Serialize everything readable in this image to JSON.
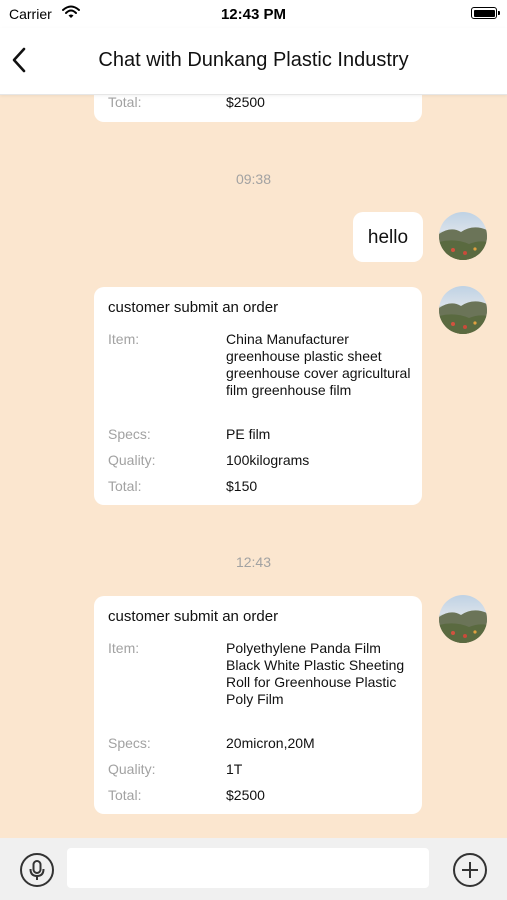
{
  "status_bar": {
    "carrier": "Carrier",
    "time": "12:43 PM"
  },
  "header": {
    "title": "Chat with Dunkang Plastic Industry"
  },
  "messages": {
    "partial_order": {
      "total_label": "Total:",
      "total_value": "$2500"
    },
    "timestamp_1": "09:38",
    "hello": "hello",
    "order_1": {
      "heading": "customer submit an order",
      "item_label": "Item:",
      "item_value": "China Manufacturer greenhouse plastic sheet greenhouse cover agricultural film greenhouse film",
      "specs_label": "Specs:",
      "specs_value": "PE film",
      "quality_label": "Quality:",
      "quality_value": "100kilograms",
      "total_label": "Total:",
      "total_value": "$150"
    },
    "timestamp_2": "12:43",
    "order_2": {
      "heading": "customer submit an order",
      "item_label": "Item:",
      "item_value": "Polyethylene Panda Film Black White Plastic Sheeting Roll for Greenhouse Plastic Poly Film",
      "specs_label": "Specs:",
      "specs_value": "20micron,20M",
      "quality_label": "Quality:",
      "quality_value": "1T",
      "total_label": "Total:",
      "total_value": "$2500"
    }
  },
  "input_bar": {
    "input_value": "",
    "placeholder": ""
  },
  "icons": {
    "back": "chevron-left-icon",
    "wifi": "wifi-icon",
    "battery": "battery-icon",
    "mic": "microphone-icon",
    "add": "plus-circle-icon",
    "avatar": "landscape-avatar"
  },
  "colors": {
    "chat_background": "#fbe6cf",
    "bubble": "#ffffff",
    "label_gray": "#a2a2a2"
  }
}
